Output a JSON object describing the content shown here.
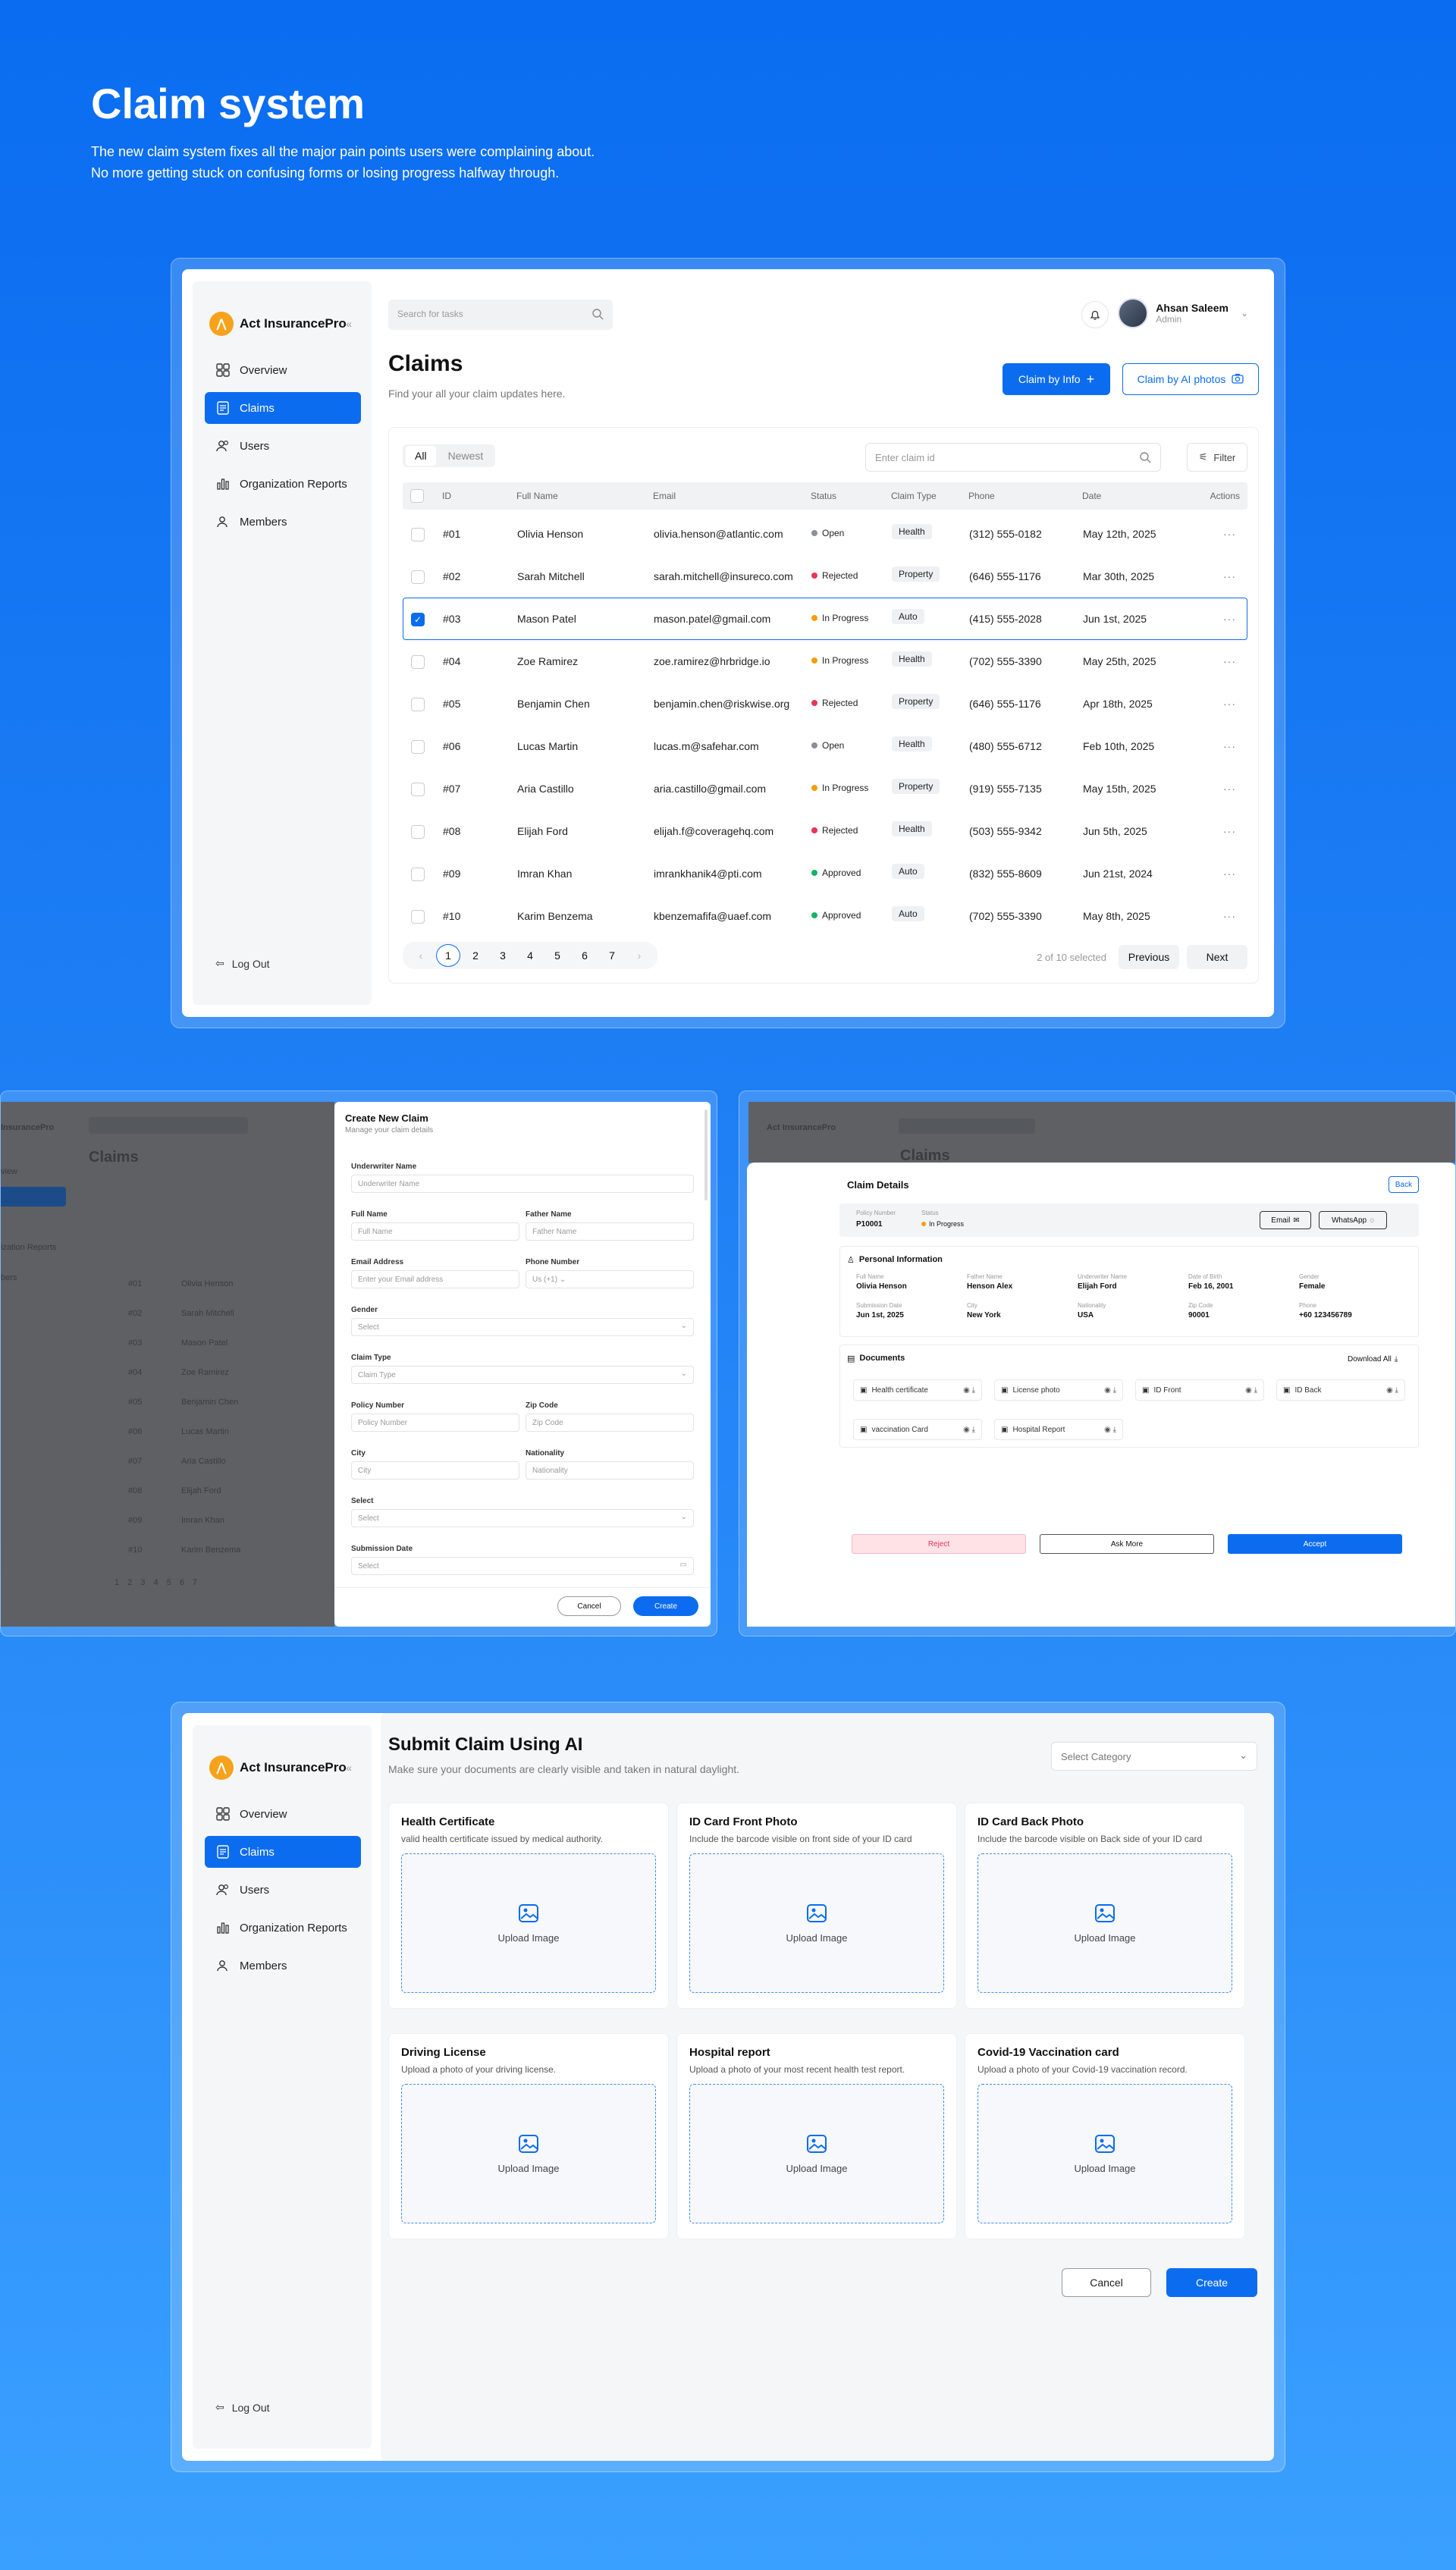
{
  "hero": {
    "title": "Claim system",
    "subtitle_line1": "The new claim system fixes all the major pain points users were complaining about.",
    "subtitle_line2": "No more getting stuck on confusing forms or losing progress halfway through."
  },
  "app": {
    "brand": "Act InsurancePro",
    "nav": [
      "Overview",
      "Claims",
      "Users",
      "Organization Reports",
      "Members"
    ],
    "logout": "Log Out",
    "search_placeholder": "Search for tasks",
    "user_name": "Ahsan Saleem",
    "user_role": "Admin"
  },
  "claims": {
    "title": "Claims",
    "subtitle": "Find your all your claim updates here.",
    "btn_info": "Claim by Info",
    "btn_ai": "Claim by AI photos",
    "tab_all": "All",
    "tab_newest": "Newest",
    "claim_id_placeholder": "Enter claim id",
    "filter": "Filter",
    "columns": [
      "ID",
      "Full Name",
      "Email",
      "Status",
      "Claim Type",
      "Phone",
      "Date",
      "Actions"
    ],
    "rows": [
      {
        "id": "#01",
        "name": "Olivia Henson",
        "email": "olivia.henson@atlantic.com",
        "status": "Open",
        "type": "Health",
        "phone": "(312) 555-0182",
        "date": "May 12th, 2025"
      },
      {
        "id": "#02",
        "name": "Sarah Mitchell",
        "email": "sarah.mitchell@insureco.com",
        "status": "Rejected",
        "type": "Property",
        "phone": "(646) 555-1176",
        "date": "Mar 30th, 2025"
      },
      {
        "id": "#03",
        "name": "Mason Patel",
        "email": "mason.patel@gmail.com",
        "status": "In Progress",
        "type": "Auto",
        "phone": "(415) 555-2028",
        "date": "Jun 1st, 2025"
      },
      {
        "id": "#04",
        "name": "Zoe Ramirez",
        "email": "zoe.ramirez@hrbridge.io",
        "status": "In Progress",
        "type": "Health",
        "phone": "(702) 555-3390",
        "date": "May 25th, 2025"
      },
      {
        "id": "#05",
        "name": "Benjamin Chen",
        "email": "benjamin.chen@riskwise.org",
        "status": "Rejected",
        "type": "Property",
        "phone": "(646) 555-1176",
        "date": "Apr 18th, 2025"
      },
      {
        "id": "#06",
        "name": "Lucas Martin",
        "email": "lucas.m@safehar.com",
        "status": "Open",
        "type": "Health",
        "phone": "(480) 555-6712",
        "date": "Feb 10th, 2025"
      },
      {
        "id": "#07",
        "name": "Aria Castillo",
        "email": "aria.castillo@gmail.com",
        "status": "In Progress",
        "type": "Property",
        "phone": "(919) 555-7135",
        "date": "May 15th, 2025"
      },
      {
        "id": "#08",
        "name": "Elijah Ford",
        "email": "elijah.f@coveragehq.com",
        "status": "Rejected",
        "type": "Health",
        "phone": "(503) 555-9342",
        "date": "Jun 5th, 2025"
      },
      {
        "id": "#09",
        "name": "Imran Khan",
        "email": "imrankhanik4@pti.com",
        "status": "Approved",
        "type": "Auto",
        "phone": "(832) 555-8609",
        "date": "Jun 21st, 2024"
      },
      {
        "id": "#10",
        "name": "Karim Benzema",
        "email": "kbenzemafifa@uaef.com",
        "status": "Approved",
        "type": "Auto",
        "phone": "(702) 555-3390",
        "date": "May 8th, 2025"
      }
    ],
    "selected_row": "#03",
    "pages": [
      "1",
      "2",
      "3",
      "4",
      "5",
      "6",
      "7"
    ],
    "current_page": "1",
    "selection_info": "2 of 10 selected",
    "prev": "Previous",
    "next": "Next",
    "status_colors": {
      "Open": "#8a8f98",
      "Rejected": "#e5355b",
      "In Progress": "#f59e0b",
      "Approved": "#16b364"
    }
  },
  "create_claim": {
    "title": "Create New Claim",
    "subtitle": "Manage your claim details",
    "fields": {
      "underwriter_label": "Underwriter Name",
      "underwriter_ph": "Underwriter Name",
      "full_name_label": "Full Name",
      "full_name_ph": "Full Name",
      "father_name_label": "Father Name",
      "father_name_ph": "Father Name",
      "email_label": "Email Address",
      "email_ph": "Enter your Email address",
      "phone_label": "Phone Number",
      "phone_code": "Us (+1)",
      "gender_label": "Gender",
      "gender_ph": "Select",
      "claim_type_label": "Claim Type",
      "claim_type_ph": "Claim Type",
      "policy_label": "Policy Number",
      "policy_ph": "Policy Number",
      "zip_label": "Zip Code",
      "zip_ph": "Zip Code",
      "city_label": "City",
      "city_ph": "City",
      "nationality_label": "Nationality",
      "nationality_ph": "Nationality",
      "select_label": "Select",
      "select_ph": "Select",
      "submission_label": "Submission Date",
      "submission_ph": "Select"
    },
    "cancel": "Cancel",
    "create": "Create",
    "bg_title": "Claims",
    "bg_brand": "InsurancePro",
    "bg_names": [
      "Olivia Henson",
      "Sarah Mitchell",
      "Mason Patel",
      "Zoe Ramirez",
      "Benjamin Chen",
      "Lucas Martin",
      "Aria Castillo",
      "Elijah Ford",
      "Imran Khan",
      "Karim Benzema"
    ],
    "bg_ids": [
      "#01",
      "#02",
      "#03",
      "#04",
      "#05",
      "#06",
      "#07",
      "#08",
      "#09",
      "#10"
    ],
    "bg_nav": [
      "view",
      "s",
      "",
      "ization Reports",
      "bers"
    ]
  },
  "claim_details": {
    "title": "Claim Details",
    "back": "Back",
    "policy_label": "Policy Number",
    "policy": "P10001",
    "status_label": "Status",
    "status": "In Progress",
    "email_btn": "Email",
    "whatsapp_btn": "WhatsApp",
    "personal_title": "Personal Information",
    "info": [
      {
        "label": "Full Name",
        "value": "Olivia Henson"
      },
      {
        "label": "Father Name",
        "value": "Henson Alex"
      },
      {
        "label": "Underwriter Name",
        "value": "Elijah Ford"
      },
      {
        "label": "Date of Birth",
        "value": "Feb 16, 2001"
      },
      {
        "label": "Gender",
        "value": "Female"
      },
      {
        "label": "Submission Date",
        "value": "Jun 1st, 2025"
      },
      {
        "label": "City",
        "value": "New York"
      },
      {
        "label": "Nationality",
        "value": "USA"
      },
      {
        "label": "Zip Code",
        "value": "90001"
      },
      {
        "label": "Phone",
        "value": "+60 123456789"
      }
    ],
    "documents_title": "Documents",
    "download_all": "Download All",
    "documents": [
      "Health certificate",
      "License photo",
      "ID Front",
      "ID Back",
      "vaccination Card",
      "Hospital Report"
    ],
    "reject": "Reject",
    "ask_more": "Ask More",
    "accept": "Accept"
  },
  "ai_submit": {
    "title": "Submit Claim Using AI",
    "subtitle": "Make sure your documents are clearly visible and taken in natural daylight.",
    "category_ph": "Select Category",
    "upload_label": "Upload Image",
    "cards": [
      {
        "title": "Health Certificate",
        "desc": "valid health certificate issued by medical authority."
      },
      {
        "title": "ID Card Front Photo",
        "desc": "Include the barcode visible on front side of your ID card"
      },
      {
        "title": "ID Card Back Photo",
        "desc": "Include the barcode visible on Back side of your ID card"
      },
      {
        "title": "Driving License",
        "desc": "Upload a photo of your driving license."
      },
      {
        "title": "Hospital report",
        "desc": "Upload a photo of your most recent health test report."
      },
      {
        "title": "Covid-19 Vaccination card",
        "desc": "Upload a photo of your Covid-19 vaccination record."
      }
    ],
    "cancel": "Cancel",
    "create": "Create"
  }
}
